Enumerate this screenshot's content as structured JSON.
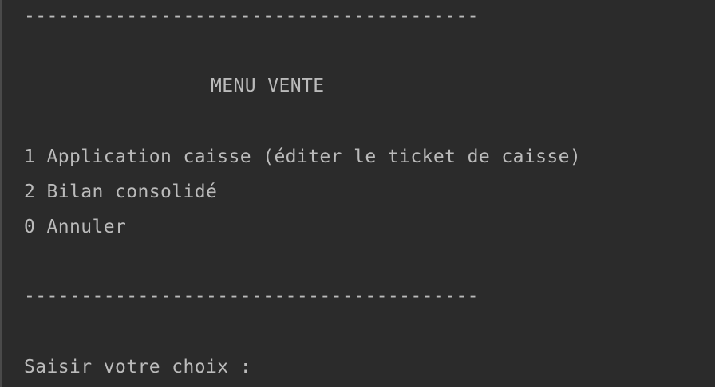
{
  "console": {
    "separator_top": "----------------------------------------",
    "title": "MENU VENTE",
    "options": [
      {
        "label": "1 Application caisse (éditer le ticket de caisse)"
      },
      {
        "label": "2 Bilan consolidé"
      },
      {
        "label": "0 Annuler"
      }
    ],
    "separator_bottom": "----------------------------------------",
    "prompt": "Saisir votre choix :"
  },
  "colors": {
    "background": "#2b2b2b",
    "text": "#bbbbbb",
    "left_border": "#4a4a4a"
  }
}
